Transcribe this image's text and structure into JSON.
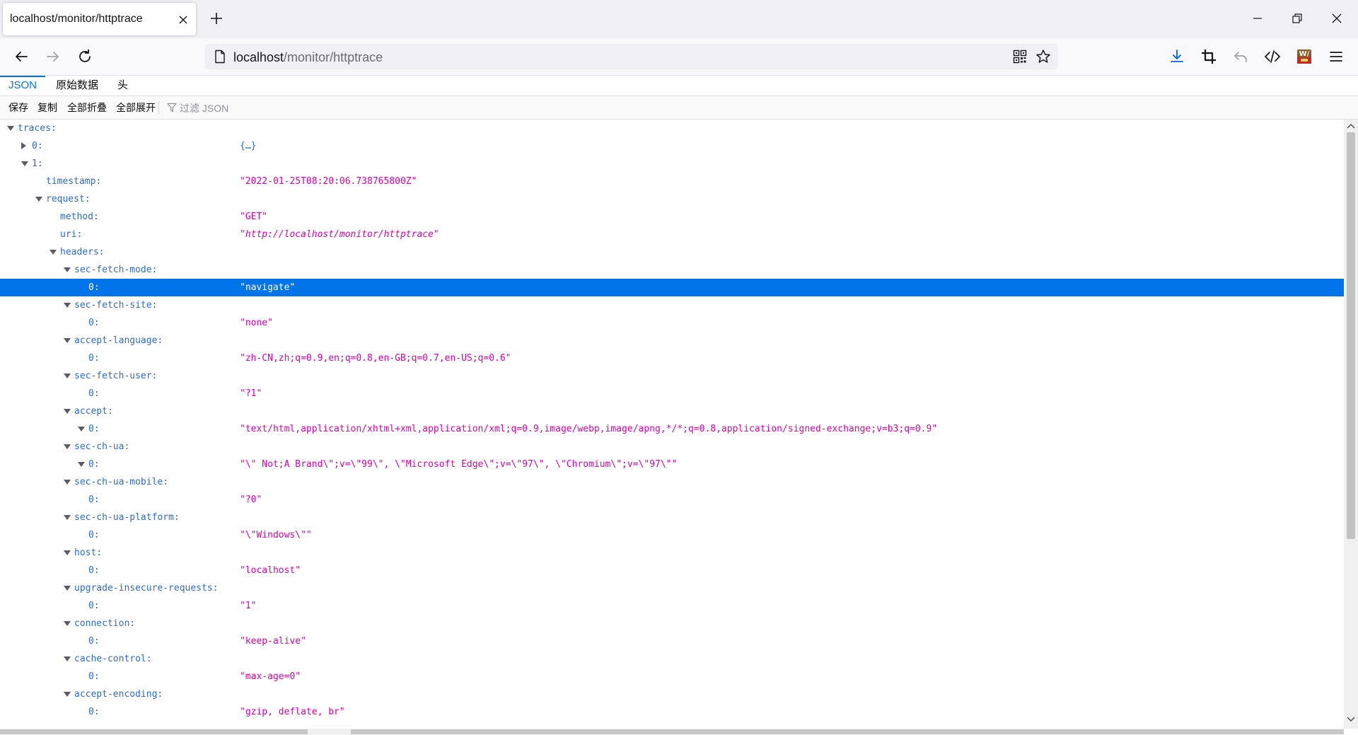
{
  "browser": {
    "tab_title": "localhost/monitor/httptrace",
    "url_host": "localhost",
    "url_path": "/monitor/httptrace",
    "icons": {
      "new_tab": "plus-icon",
      "back": "back-arrow-icon",
      "forward": "forward-arrow-icon",
      "reload": "reload-icon",
      "page": "page-icon",
      "qr": "qr-code-icon",
      "bookmark": "star-icon",
      "downloads": "download-icon",
      "screenshot": "crop-icon",
      "undo": "undo-icon",
      "devtools": "code-icon",
      "extension": "wa-extension-icon",
      "menu": "hamburger-menu-icon"
    }
  },
  "viewer": {
    "tabs": [
      "JSON",
      "原始数据",
      "头"
    ],
    "toolbar": {
      "save": "保存",
      "copy": "复制",
      "collapse_all": "全部折叠",
      "expand_all": "全部展开",
      "filter_placeholder": "过滤 JSON"
    }
  },
  "tree": [
    {
      "depth": 0,
      "twisty": "open",
      "key": "traces:",
      "value": ""
    },
    {
      "depth": 1,
      "twisty": "closed",
      "key": "0:",
      "value": "{…}",
      "value_type": "brace"
    },
    {
      "depth": 1,
      "twisty": "open",
      "key": "1:",
      "value": ""
    },
    {
      "depth": 2,
      "twisty": "none",
      "key": "timestamp:",
      "value": "\"2022-01-25T08:20:06.738765800Z\""
    },
    {
      "depth": 2,
      "twisty": "open",
      "key": "request:",
      "value": ""
    },
    {
      "depth": 3,
      "twisty": "none",
      "key": "method:",
      "value": "\"GET\""
    },
    {
      "depth": 3,
      "twisty": "none",
      "key": "uri:",
      "value": "\"http://localhost/monitor/httptrace\"",
      "value_type": "url"
    },
    {
      "depth": 3,
      "twisty": "open",
      "key": "headers:",
      "value": ""
    },
    {
      "depth": 4,
      "twisty": "open",
      "key": "sec-fetch-mode:",
      "value": ""
    },
    {
      "depth": 5,
      "twisty": "none",
      "key": "0:",
      "value": "\"navigate\"",
      "selected": true
    },
    {
      "depth": 4,
      "twisty": "open",
      "key": "sec-fetch-site:",
      "value": ""
    },
    {
      "depth": 5,
      "twisty": "none",
      "key": "0:",
      "value": "\"none\""
    },
    {
      "depth": 4,
      "twisty": "open",
      "key": "accept-language:",
      "value": ""
    },
    {
      "depth": 5,
      "twisty": "none",
      "key": "0:",
      "value": "\"zh-CN,zh;q=0.9,en;q=0.8,en-GB;q=0.7,en-US;q=0.6\""
    },
    {
      "depth": 4,
      "twisty": "open",
      "key": "sec-fetch-user:",
      "value": ""
    },
    {
      "depth": 5,
      "twisty": "none",
      "key": "0:",
      "value": "\"?1\""
    },
    {
      "depth": 4,
      "twisty": "open",
      "key": "accept:",
      "value": ""
    },
    {
      "depth": 5,
      "twisty": "open",
      "key": "0:",
      "value": "\"text/html,application/xhtml+xml,application/xml;q=0.9,image/webp,image/apng,*/*;q=0.8,application/signed-exchange;v=b3;q=0.9\""
    },
    {
      "depth": 4,
      "twisty": "open",
      "key": "sec-ch-ua:",
      "value": ""
    },
    {
      "depth": 5,
      "twisty": "open",
      "key": "0:",
      "value": "\"\\\" Not;A Brand\\\";v=\\\"99\\\", \\\"Microsoft Edge\\\";v=\\\"97\\\", \\\"Chromium\\\";v=\\\"97\\\"\""
    },
    {
      "depth": 4,
      "twisty": "open",
      "key": "sec-ch-ua-mobile:",
      "value": ""
    },
    {
      "depth": 5,
      "twisty": "none",
      "key": "0:",
      "value": "\"?0\""
    },
    {
      "depth": 4,
      "twisty": "open",
      "key": "sec-ch-ua-platform:",
      "value": ""
    },
    {
      "depth": 5,
      "twisty": "none",
      "key": "0:",
      "value": "\"\\\"Windows\\\"\""
    },
    {
      "depth": 4,
      "twisty": "open",
      "key": "host:",
      "value": ""
    },
    {
      "depth": 5,
      "twisty": "none",
      "key": "0:",
      "value": "\"localhost\""
    },
    {
      "depth": 4,
      "twisty": "open",
      "key": "upgrade-insecure-requests:",
      "value": ""
    },
    {
      "depth": 5,
      "twisty": "none",
      "key": "0:",
      "value": "\"1\""
    },
    {
      "depth": 4,
      "twisty": "open",
      "key": "connection:",
      "value": ""
    },
    {
      "depth": 5,
      "twisty": "none",
      "key": "0:",
      "value": "\"keep-alive\""
    },
    {
      "depth": 4,
      "twisty": "open",
      "key": "cache-control:",
      "value": ""
    },
    {
      "depth": 5,
      "twisty": "none",
      "key": "0:",
      "value": "\"max-age=0\""
    },
    {
      "depth": 4,
      "twisty": "open",
      "key": "accept-encoding:",
      "value": ""
    },
    {
      "depth": 5,
      "twisty": "none",
      "key": "0:",
      "value": "\"gzip, deflate, br\""
    }
  ],
  "colors": {
    "selected_row": "#0074e8",
    "key": "#2e6ad1",
    "string_value": "#dd00a9"
  }
}
